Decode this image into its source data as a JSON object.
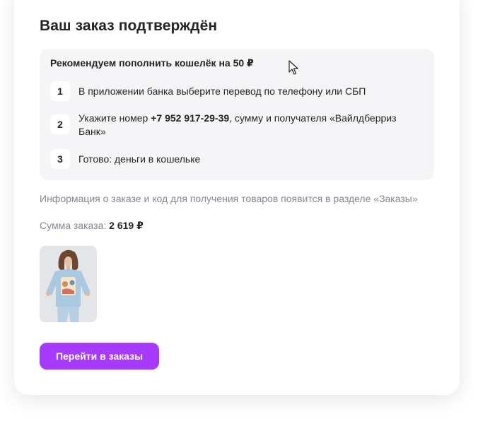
{
  "order": {
    "title": "Ваш заказ подтверждён",
    "recommend": {
      "heading": "Рекомендуем пополнить кошелёк на 50 ₽",
      "steps": [
        {
          "num": "1",
          "text": "В приложении банка выберите перевод по телефону или СБП"
        },
        {
          "num": "2",
          "text_before": "Укажите номер ",
          "phone": "+7 952 917-29-39",
          "text_after": ", сумму и получателя «Вайлдберриз Банк»"
        },
        {
          "num": "3",
          "text": "Готово: деньги в кошельке"
        }
      ]
    },
    "info_note": "Информация о заказе и код для получения товаров появится в разделе «Заказы»",
    "sum_label": "Сумма заказа: ",
    "sum_value": "2 619 ₽",
    "product_image": "product-photo",
    "button_label": "Перейти в заказы",
    "accent_color": "#a73afd"
  }
}
